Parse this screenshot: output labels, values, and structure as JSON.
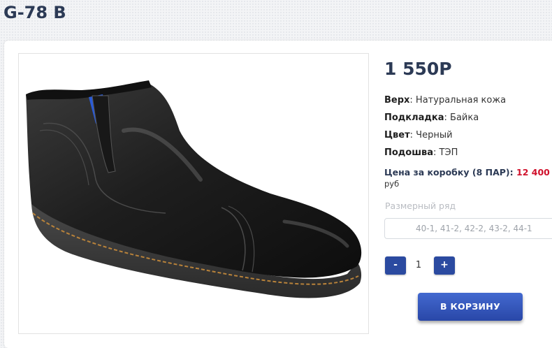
{
  "product": {
    "title": "G-78 B",
    "price": "1 550P",
    "photo_alt": "shoe-photo"
  },
  "specs": [
    {
      "label": "Верх",
      "value": ": Натуральная кожа"
    },
    {
      "label": "Подкладка",
      "value": ": Байка"
    },
    {
      "label": "Цвет",
      "value": ": Черный"
    },
    {
      "label": "Подошва",
      "value": ": ТЭП"
    }
  ],
  "box_price": {
    "label": "Цена за коробку (8 ПАР): ",
    "value": "12 400",
    "currency": "руб"
  },
  "sizes": {
    "label": "Размерный ряд",
    "value": "40-1, 41-2, 42-2, 43-2, 44-1"
  },
  "quantity": {
    "minus": "-",
    "value": "1",
    "plus": "+"
  },
  "cart_button": "В КОРЗИНУ",
  "colors": {
    "accent": "#2b4aa0",
    "price_red": "#d0102b",
    "title": "#2c3a55"
  }
}
